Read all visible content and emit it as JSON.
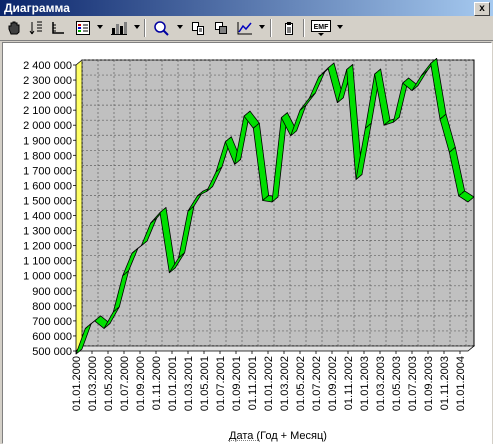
{
  "window": {
    "title": "Диаграмма",
    "close_glyph": "x"
  },
  "toolbar": {
    "icons": [
      "hand-icon",
      "arrange-icon",
      "axis-icon",
      "legend-icon",
      "chart-type-icon",
      "zoom-icon",
      "copy-data-icon",
      "copy-image-icon",
      "chart-line-icon",
      "clipboard-icon",
      "export-emf-icon"
    ],
    "export_label": "EMF"
  },
  "chart_data": {
    "type": "area",
    "style": "3d-ribbon",
    "series_color": "#00e000",
    "wall_color": "#c0c0c0",
    "floor_color": "#ffff66",
    "xlabel": "Дата (Год + Месяц)",
    "ylabel": "",
    "ylim": [
      500000,
      2400000
    ],
    "yticks": [
      "500 000",
      "600 000",
      "700 000",
      "800 000",
      "900 000",
      "1 000 000",
      "1 100 000",
      "1 200 000",
      "1 300 000",
      "1 400 000",
      "1 500 000",
      "1 600 000",
      "1 700 000",
      "1 800 000",
      "1 900 000",
      "2 000 000",
      "2 100 000",
      "2 200 000",
      "2 300 000",
      "2 400 000"
    ],
    "xticks": [
      "01.01.2000",
      "01.03.2000",
      "01.05.2000",
      "01.07.2000",
      "01.09.2000",
      "01.11.2000",
      "01.01.2001",
      "01.03.2001",
      "01.05.2001",
      "01.07.2001",
      "01.09.2001",
      "01.11.2001",
      "01.01.2002",
      "01.03.2002",
      "01.05.2002",
      "01.07.2002",
      "01.09.2002",
      "01.11.2002",
      "01.01.2003",
      "01.03.2003",
      "01.05.2003",
      "01.07.2003",
      "01.09.2003",
      "01.11.2003",
      "01.01.2004"
    ],
    "grid": true,
    "x": [
      "01.01.2000",
      "01.02.2000",
      "01.03.2000",
      "01.04.2000",
      "01.05.2000",
      "01.06.2000",
      "01.07.2000",
      "01.08.2000",
      "01.09.2000",
      "01.10.2000",
      "01.11.2000",
      "01.12.2000",
      "01.01.2001",
      "01.02.2001",
      "01.03.2001",
      "01.04.2001",
      "01.05.2001",
      "01.06.2001",
      "01.07.2001",
      "01.08.2001",
      "01.09.2001",
      "01.10.2001",
      "01.11.2001",
      "01.12.2001",
      "01.01.2002",
      "01.02.2002",
      "01.03.2002",
      "01.04.2002",
      "01.05.2002",
      "01.06.2002",
      "01.07.2002",
      "01.08.2002",
      "01.09.2002",
      "01.10.2002",
      "01.11.2002",
      "01.12.2002",
      "01.01.2003",
      "01.02.2003",
      "01.03.2003",
      "01.04.2003",
      "01.05.2003",
      "01.06.2003",
      "01.07.2003",
      "01.08.2003",
      "01.09.2003",
      "01.10.2003",
      "01.11.2003",
      "01.12.2003",
      "01.01.2004",
      "01.02.2004"
    ],
    "series": [
      {
        "values": [
          480000,
          650000,
          700000,
          650000,
          760000,
          1000000,
          1150000,
          1200000,
          1350000,
          1420000,
          1020000,
          1120000,
          1430000,
          1530000,
          1560000,
          1690000,
          1890000,
          1740000,
          2060000,
          1980000,
          1500000,
          1490000,
          2050000,
          1930000,
          2100000,
          2180000,
          2320000,
          2380000,
          2150000,
          2370000,
          1640000,
          1980000,
          2340000,
          2000000,
          2020000,
          2280000,
          2230000,
          2330000,
          2410000,
          2040000,
          1820000,
          1530000,
          1490000
        ]
      }
    ]
  }
}
